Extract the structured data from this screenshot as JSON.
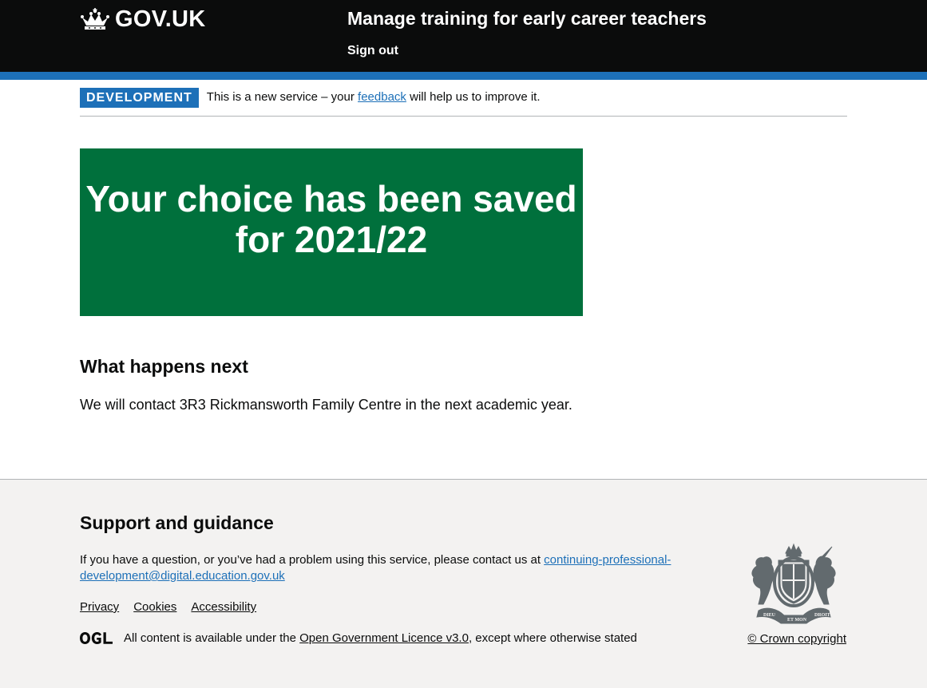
{
  "header": {
    "logo_text": "GOV.UK",
    "service_name": "Manage training for early career teachers",
    "sign_out": "Sign out"
  },
  "phase_banner": {
    "tag": "DEVELOPMENT",
    "text_before": "This is a new service – your ",
    "link": "feedback",
    "text_after": " will help us to improve it."
  },
  "panel": {
    "title": "Your choice has been saved for 2021/22"
  },
  "main": {
    "heading": "What happens next",
    "body": "We will contact 3R3 Rickmansworth Family Centre in the next academic year."
  },
  "footer": {
    "heading": "Support and guidance",
    "contact_text": "If you have a question, or you’ve had a problem using this service, please contact us at ",
    "contact_email": "continuing-professional-development@digital.education.gov.uk",
    "links": [
      "Privacy",
      "Cookies",
      "Accessibility"
    ],
    "licence_before": "All content is available under the ",
    "licence_link": "Open Government Licence v3.0",
    "licence_after": ", except where otherwise stated",
    "copyright": "© Crown copyright"
  },
  "colors": {
    "header_bg": "#0b0c0c",
    "header_stripe": "#1d70b8",
    "panel_bg": "#00703c",
    "link": "#1d70b8",
    "footer_bg": "#f3f2f1"
  },
  "icons": [
    "crown-icon",
    "ogl-logo-icon",
    "royal-coat-of-arms-icon"
  ]
}
